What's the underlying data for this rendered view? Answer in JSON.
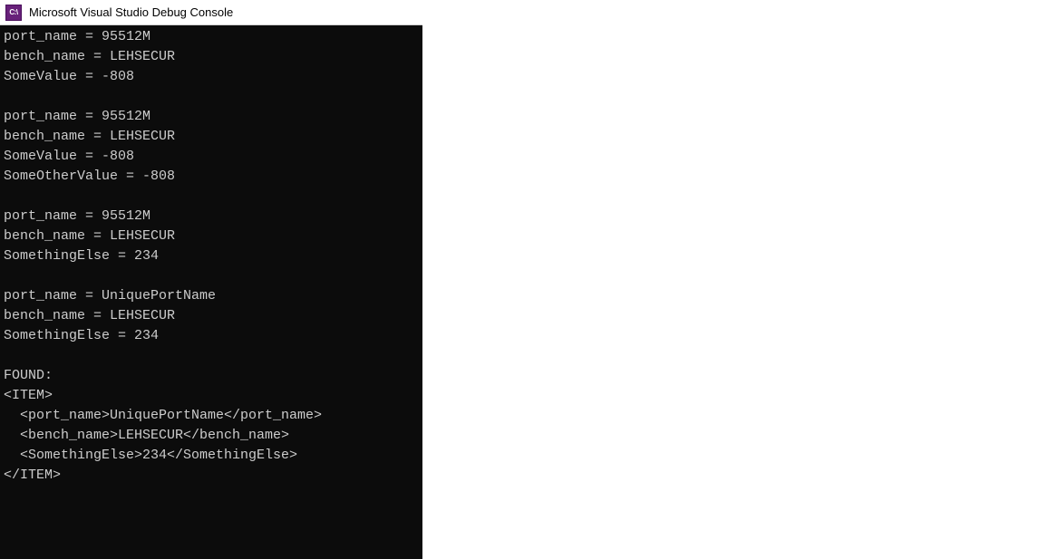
{
  "titlebar": {
    "icon_label": "C:\\",
    "title": "Microsoft Visual Studio Debug Console"
  },
  "console": {
    "lines": [
      "port_name = 95512M",
      "bench_name = LEHSECUR",
      "SomeValue = -808",
      "",
      "port_name = 95512M",
      "bench_name = LEHSECUR",
      "SomeValue = -808",
      "SomeOtherValue = -808",
      "",
      "port_name = 95512M",
      "bench_name = LEHSECUR",
      "SomethingElse = 234",
      "",
      "port_name = UniquePortName",
      "bench_name = LEHSECUR",
      "SomethingElse = 234",
      "",
      "FOUND:",
      "<ITEM>",
      "  <port_name>UniquePortName</port_name>",
      "  <bench_name>LEHSECUR</bench_name>",
      "  <SomethingElse>234</SomethingElse>",
      "</ITEM>"
    ]
  }
}
